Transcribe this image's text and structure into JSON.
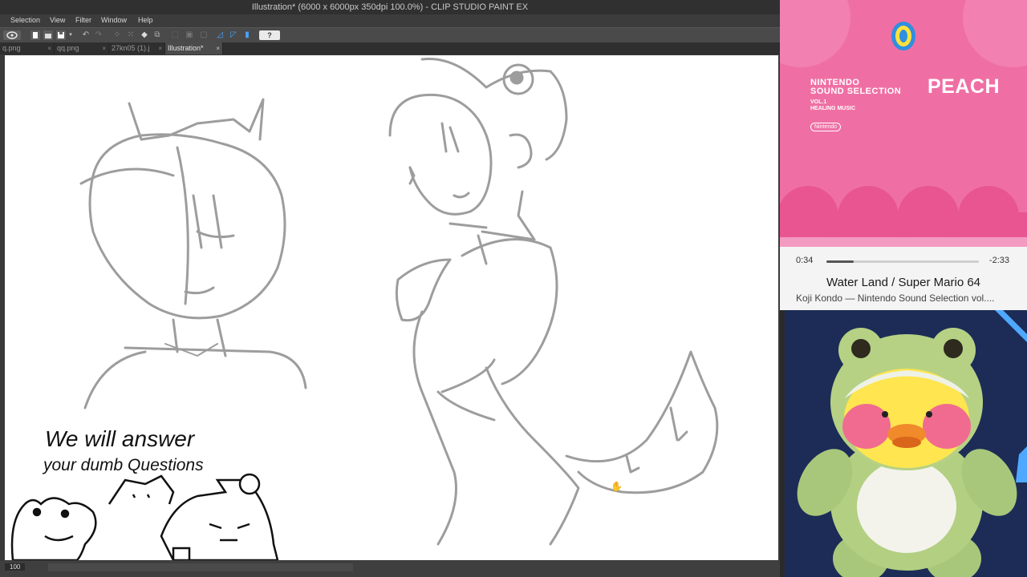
{
  "window": {
    "title": "Illustration* (6000 x 6000px 350dpi 100.0%)  - CLIP STUDIO PAINT EX"
  },
  "menu": [
    "Selection",
    "View",
    "Filter",
    "Window",
    "Help"
  ],
  "toolbar": {
    "help_label": "?"
  },
  "tabs": [
    {
      "label": "q.png",
      "active": false
    },
    {
      "label": "qq.png",
      "active": false
    },
    {
      "label": "27kn05 (1).j",
      "active": false
    },
    {
      "label": "Illustration*",
      "active": true
    }
  ],
  "canvas": {
    "handwriting_line1": "We will answer",
    "handwriting_line2": "your dumb Questions"
  },
  "statusbar": {
    "zoom": "100"
  },
  "music": {
    "cover": {
      "series_line1": "NINTENDO",
      "series_line2": "SOUND SELECTION",
      "volume_line1": "VOL.1",
      "volume_line2": "HEALING MUSIC",
      "brand": "Nintendo",
      "title": "PEACH",
      "bg_color": "#ef6fa4"
    },
    "elapsed": "0:34",
    "remaining": "-2:33",
    "progress": 0.18,
    "song_title": "Water Land / Super Mario 64",
    "artist_line": "Koji Kondo — Nintendo Sound Selection vol...."
  },
  "colors": {
    "accent_pink": "#ef6fa4",
    "dark_pink": "#e85590",
    "webcam_bg": "#1c2c57",
    "accent_blue": "#2f8fe0"
  }
}
